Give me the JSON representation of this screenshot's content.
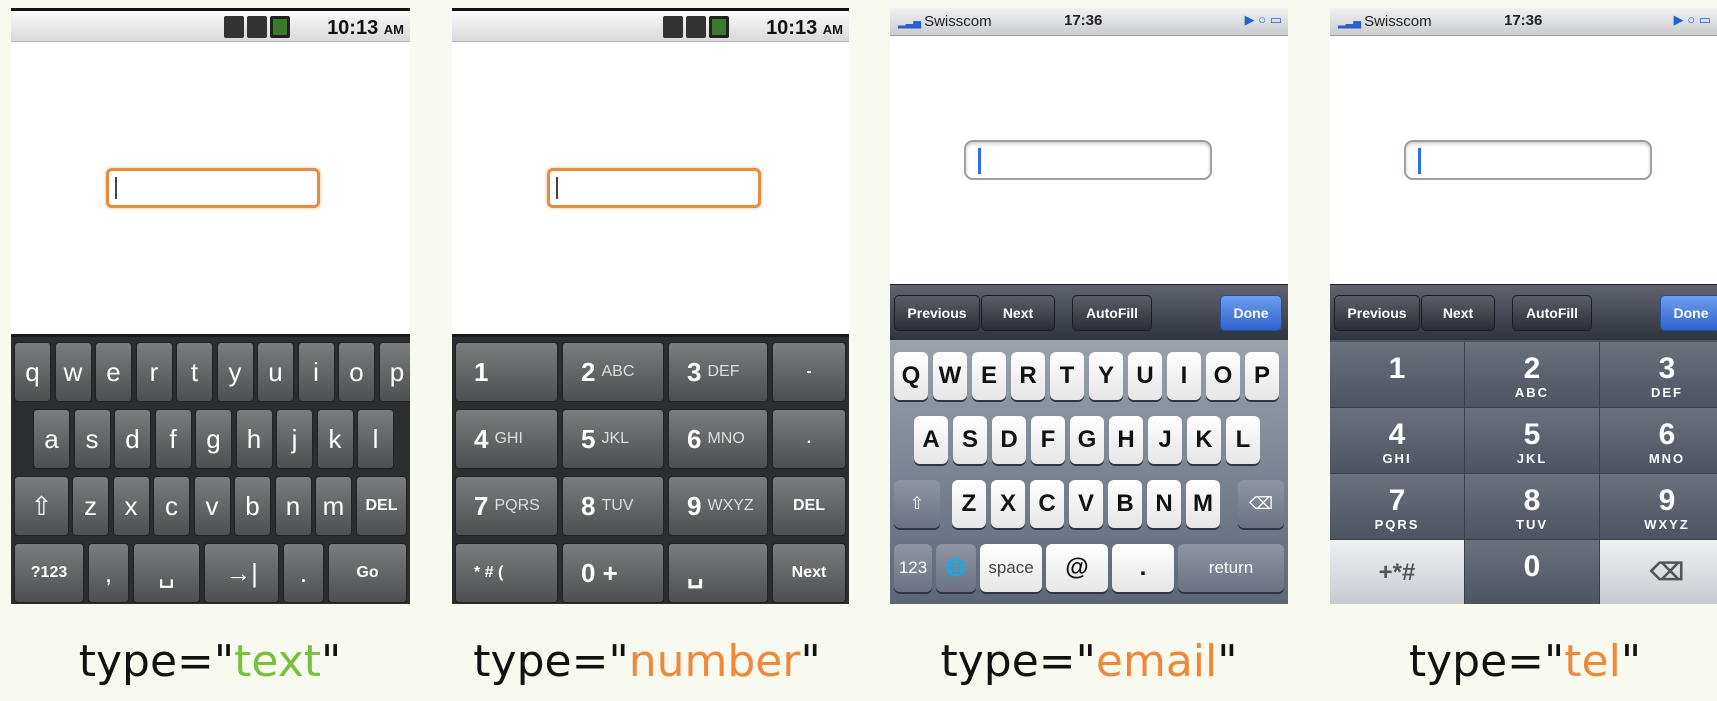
{
  "panels": {
    "android_text": {
      "status": {
        "time": "10:13",
        "ampm": "AM"
      },
      "keys": {
        "row1": [
          "q",
          "w",
          "e",
          "r",
          "t",
          "y",
          "u",
          "i",
          "o",
          "p"
        ],
        "row2": [
          "a",
          "s",
          "d",
          "f",
          "g",
          "h",
          "j",
          "k",
          "l"
        ],
        "row3": [
          "z",
          "x",
          "c",
          "v",
          "b",
          "n",
          "m"
        ],
        "del": "DEL",
        "sym": "?123",
        "comma": ",",
        "tab": "→|",
        "period": ".",
        "go": "Go"
      },
      "caption": {
        "prefix": "type=\"",
        "keyword": "text",
        "suffix": "\""
      }
    },
    "android_number": {
      "status": {
        "time": "10:13",
        "ampm": "AM"
      },
      "keys": [
        {
          "n": "1",
          "l": ""
        },
        {
          "n": "2",
          "l": "ABC"
        },
        {
          "n": "3",
          "l": "DEF"
        },
        {
          "n": "-",
          "l": ""
        },
        {
          "n": "4",
          "l": "GHI"
        },
        {
          "n": "5",
          "l": "JKL"
        },
        {
          "n": "6",
          "l": "MNO"
        },
        {
          "n": ".",
          "l": ""
        },
        {
          "n": "7",
          "l": "PQRS"
        },
        {
          "n": "8",
          "l": "TUV"
        },
        {
          "n": "9",
          "l": "WXYZ"
        },
        {
          "n": "DEL",
          "l": ""
        },
        {
          "n": "* # (",
          "l": ""
        },
        {
          "n": "0 +",
          "l": ""
        },
        {
          "n": "␣",
          "l": ""
        },
        {
          "n": "Next",
          "l": ""
        }
      ],
      "caption": {
        "prefix": "type=\"",
        "keyword": "number",
        "suffix": "\""
      }
    },
    "ios_email": {
      "status": {
        "carrier": "Swisscom",
        "time": "17:36",
        "icons": "▶ ○ ▭"
      },
      "toolbar": {
        "previous": "Previous",
        "next": "Next",
        "autofill": "AutoFill",
        "done": "Done"
      },
      "keys": {
        "row1": [
          "Q",
          "W",
          "E",
          "R",
          "T",
          "Y",
          "U",
          "I",
          "O",
          "P"
        ],
        "row2": [
          "A",
          "S",
          "D",
          "F",
          "G",
          "H",
          "J",
          "K",
          "L"
        ],
        "row3": [
          "Z",
          "X",
          "C",
          "V",
          "B",
          "N",
          "M"
        ],
        "shift": "⇧",
        "backspace": "⌫",
        "num": "123",
        "globe": "🌐",
        "space": "space",
        "at": "@",
        "dot": ".",
        "return": "return"
      },
      "caption": {
        "prefix": "type=\"",
        "keyword": "email",
        "suffix": "\""
      }
    },
    "ios_tel": {
      "status": {
        "carrier": "Swisscom",
        "time": "17:36",
        "icons": "▶ ○ ▭"
      },
      "toolbar": {
        "previous": "Previous",
        "next": "Next",
        "autofill": "AutoFill",
        "done": "Done"
      },
      "keys": [
        {
          "n": "1",
          "l": ""
        },
        {
          "n": "2",
          "l": "ABC"
        },
        {
          "n": "3",
          "l": "DEF"
        },
        {
          "n": "4",
          "l": "GHI"
        },
        {
          "n": "5",
          "l": "JKL"
        },
        {
          "n": "6",
          "l": "MNO"
        },
        {
          "n": "7",
          "l": "PQRS"
        },
        {
          "n": "8",
          "l": "TUV"
        },
        {
          "n": "9",
          "l": "WXYZ"
        },
        {
          "n": "+*#",
          "l": ""
        },
        {
          "n": "0",
          "l": ""
        },
        {
          "n": "⌫",
          "l": ""
        }
      ],
      "caption": {
        "prefix": "type=\"",
        "keyword": "tel",
        "suffix": "\""
      }
    }
  },
  "colors": {
    "android_focus": "#e28d3f",
    "ios_caret": "#2b6ee8",
    "caption_green": "#7bbf3f",
    "caption_orange": "#f0883a"
  }
}
